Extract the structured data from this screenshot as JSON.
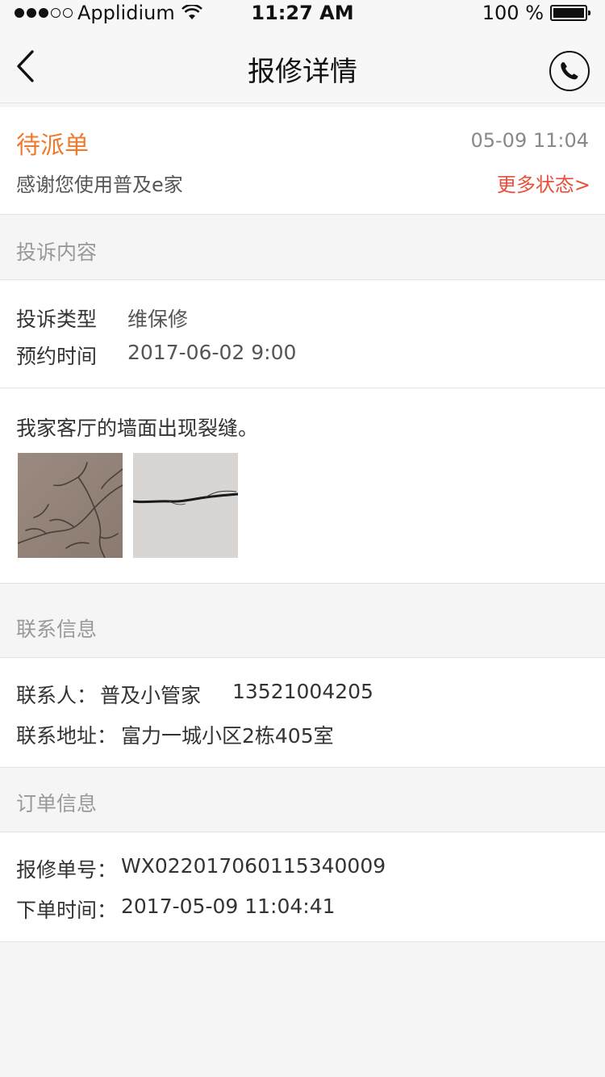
{
  "status_bar": {
    "carrier": "Applidium",
    "time": "11:27 AM",
    "battery": "100 %"
  },
  "nav": {
    "title": "报修详情",
    "back_icon": "chevron-left-icon",
    "call_icon": "phone-icon"
  },
  "order_status": {
    "state": "待派单",
    "time": "05-09 11:04",
    "message": "感谢您使用普及e家",
    "more_link": "更多状态>",
    "state_color": "#f07a2a",
    "link_color": "#e8503a"
  },
  "complaint": {
    "section_title": "投诉内容",
    "type_label": "投诉类型",
    "type_value": "维保修",
    "appointment_label": "预约时间",
    "appointment_value": "2017-06-02 9:00",
    "description": "我家客厅的墙面出现裂缝。",
    "photos": [
      "wall-crack-photo-1",
      "wall-crack-photo-2"
    ]
  },
  "contact": {
    "section_title": "联系信息",
    "person_label": "联系人：",
    "person_value": "普及小管家",
    "phone": "13521004205",
    "address_label": "联系地址：",
    "address_value": "富力一城小区2栋405室"
  },
  "order_info": {
    "section_title": "订单信息",
    "number_label": "报修单号：",
    "number_value": "WX022017060115340009",
    "created_label": "下单时间：",
    "created_value": "2017-05-09 11:04:41"
  }
}
